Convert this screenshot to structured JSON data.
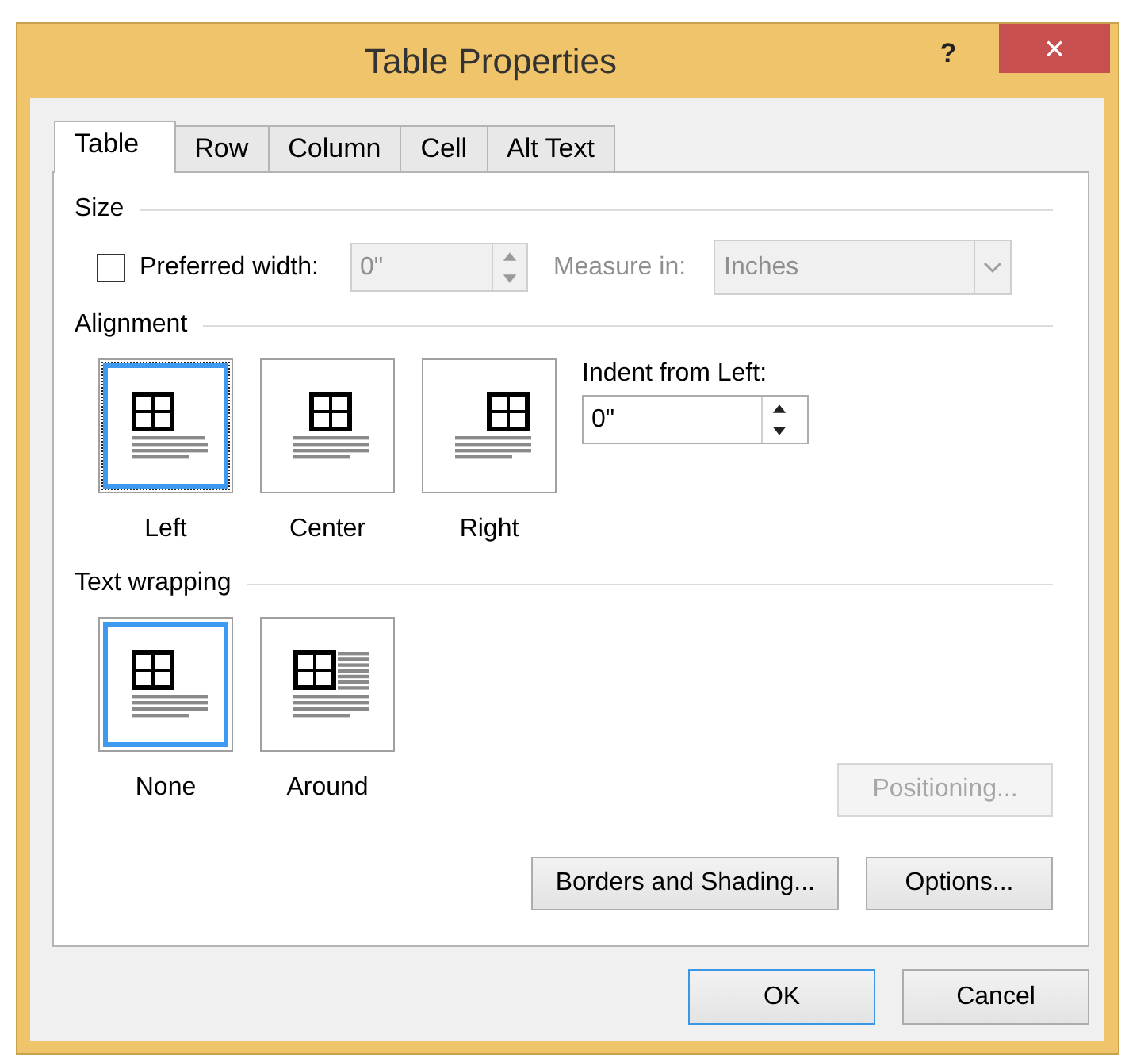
{
  "window": {
    "title": "Table Properties",
    "help": "?",
    "close": "×"
  },
  "tabs": [
    {
      "label": "Table",
      "selected": true
    },
    {
      "label": "Row",
      "selected": false
    },
    {
      "label": "Column",
      "selected": false
    },
    {
      "label": "Cell",
      "selected": false
    },
    {
      "label": "Alt Text",
      "selected": false
    }
  ],
  "size": {
    "heading": "Size",
    "preferred_width": {
      "label": "Preferred width:",
      "checked": false
    },
    "width_field": {
      "value": "0\"",
      "disabled": true
    },
    "measure_in": {
      "label": "Measure in:",
      "value": "Inches",
      "disabled": true
    }
  },
  "alignment": {
    "heading": "Alignment",
    "options": [
      {
        "label": "Left",
        "kind": "left",
        "selected": true,
        "focused": true
      },
      {
        "label": "Center",
        "kind": "center",
        "selected": false,
        "focused": false
      },
      {
        "label": "Right",
        "kind": "right",
        "selected": false,
        "focused": false
      }
    ],
    "indent": {
      "label": "Indent from Left:",
      "value": "0\""
    }
  },
  "text_wrapping": {
    "heading": "Text wrapping",
    "options": [
      {
        "label": "None",
        "kind": "none",
        "selected": true,
        "focused": false
      },
      {
        "label": "Around",
        "kind": "around",
        "selected": false,
        "focused": false
      }
    ]
  },
  "positioning_button": {
    "label": "Positioning...",
    "disabled": true
  },
  "panel_buttons": [
    {
      "label": "Borders and Shading...",
      "disabled": false
    },
    {
      "label": "Options...",
      "disabled": false
    }
  ],
  "dialog_buttons": [
    {
      "label": "OK",
      "default": true
    },
    {
      "label": "Cancel",
      "default": false
    }
  ]
}
